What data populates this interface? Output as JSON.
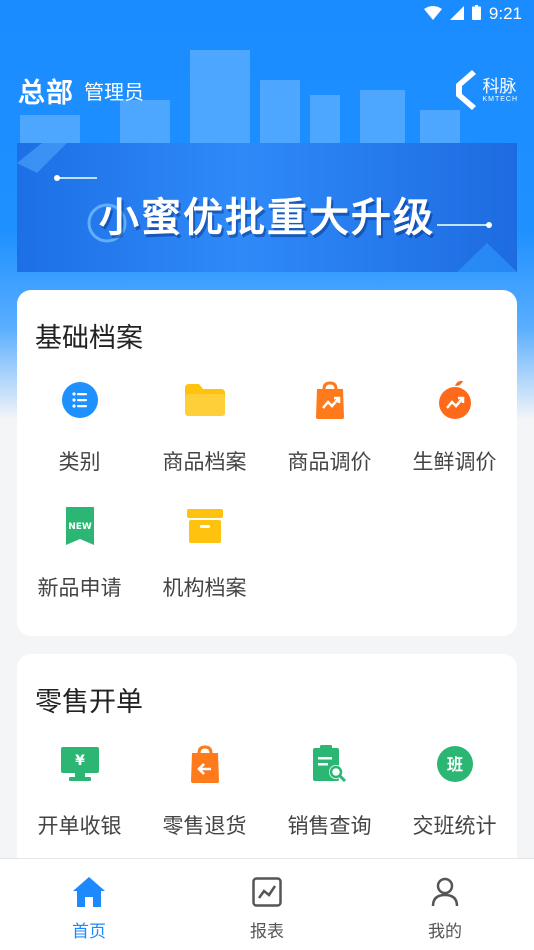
{
  "status_bar": {
    "time": "9:21"
  },
  "header": {
    "org": "总部",
    "role": "管理员",
    "brand_name": "科脉",
    "brand_sub": "KMTECH"
  },
  "banner": {
    "title": "小蜜优批重大升级"
  },
  "sections": [
    {
      "title": "基础档案",
      "items": [
        {
          "label": "类别",
          "icon": "list-icon",
          "color": "#1e90ff"
        },
        {
          "label": "商品档案",
          "icon": "folder-icon",
          "color": "#ffc20e"
        },
        {
          "label": "商品调价",
          "icon": "shopping-bag-trend-icon",
          "color": "#ff7a1a"
        },
        {
          "label": "生鲜调价",
          "icon": "fruit-trend-icon",
          "color": "#ff6a1a"
        },
        {
          "label": "新品申请",
          "icon": "new-badge-icon",
          "color": "#2bb673"
        },
        {
          "label": "机构档案",
          "icon": "archive-box-icon",
          "color": "#ffc20e"
        }
      ]
    },
    {
      "title": "零售开单",
      "items": [
        {
          "label": "开单收银",
          "icon": "cash-register-icon",
          "color": "#2bb673"
        },
        {
          "label": "零售退货",
          "icon": "return-bag-icon",
          "color": "#ff7a1a"
        },
        {
          "label": "销售查询",
          "icon": "sales-search-icon",
          "color": "#2bb673"
        },
        {
          "label": "交班统计",
          "icon": "shift-stats-icon",
          "color": "#2bb673",
          "glyph": "班"
        }
      ]
    }
  ],
  "tabbar": [
    {
      "label": "首页",
      "icon": "home-icon",
      "active": true
    },
    {
      "label": "报表",
      "icon": "chart-icon",
      "active": false
    },
    {
      "label": "我的",
      "icon": "user-icon",
      "active": false
    }
  ],
  "colors": {
    "primary": "#1e88ff",
    "hero_bg": "#1a8cff"
  }
}
